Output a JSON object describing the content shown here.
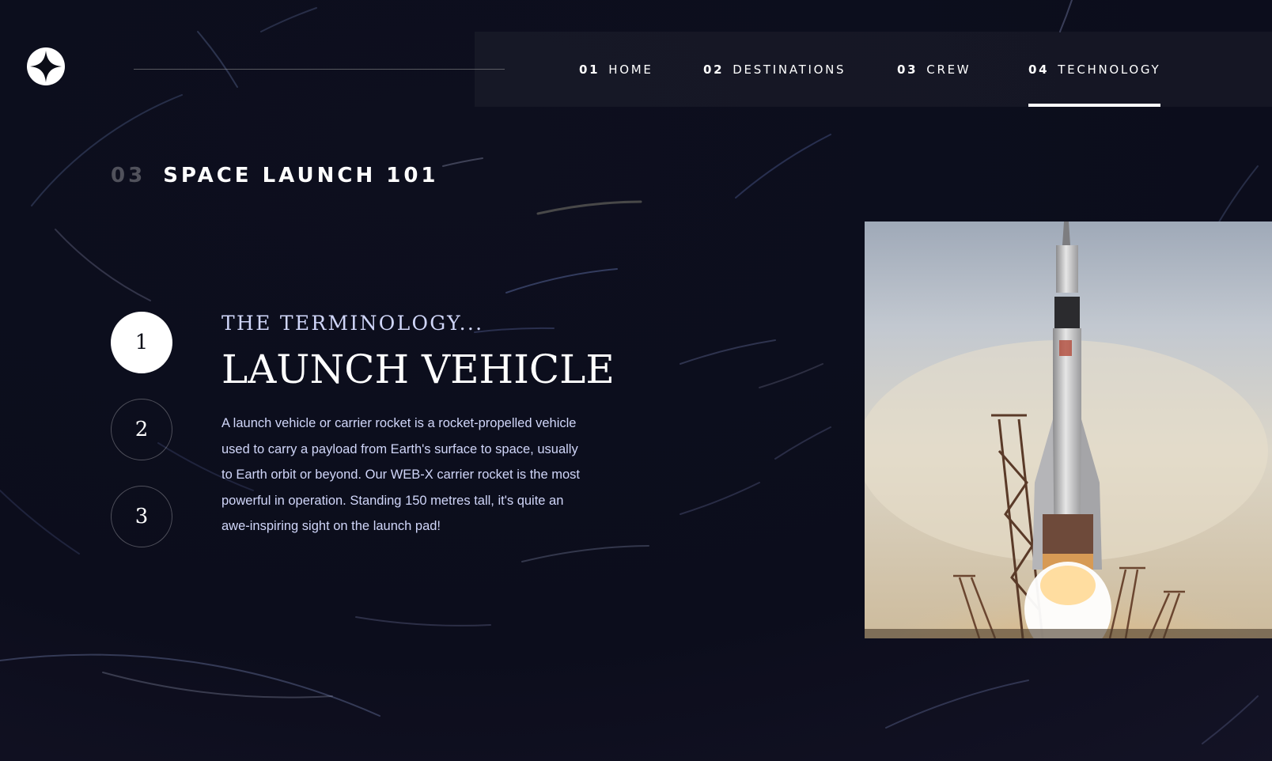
{
  "header": {
    "logo_icon": "star-logo-icon",
    "nav": [
      {
        "num": "01",
        "label": "HOME",
        "active": false
      },
      {
        "num": "02",
        "label": "DESTINATIONS",
        "active": false
      },
      {
        "num": "03",
        "label": "CREW",
        "active": false
      },
      {
        "num": "04",
        "label": "TECHNOLOGY",
        "active": true
      }
    ]
  },
  "page": {
    "heading_num": "03",
    "heading_text": "SPACE LAUNCH 101"
  },
  "technology": {
    "steps": [
      "1",
      "2",
      "3"
    ],
    "active_step": "1",
    "subheading": "THE TERMINOLOGY...",
    "title": "LAUNCH VEHICLE",
    "description": "A launch vehicle or carrier rocket is a rocket-propelled vehicle used to carry a payload from Earth's surface to space, usually to Earth orbit or beyond. Our WEB-X carrier rocket is the most powerful in operation. Standing 150 metres tall, it's quite an awe-inspiring sight on the launch pad!"
  },
  "colors": {
    "background": "#0b0d17",
    "accent_text": "#d0d6f9",
    "white": "#ffffff"
  }
}
